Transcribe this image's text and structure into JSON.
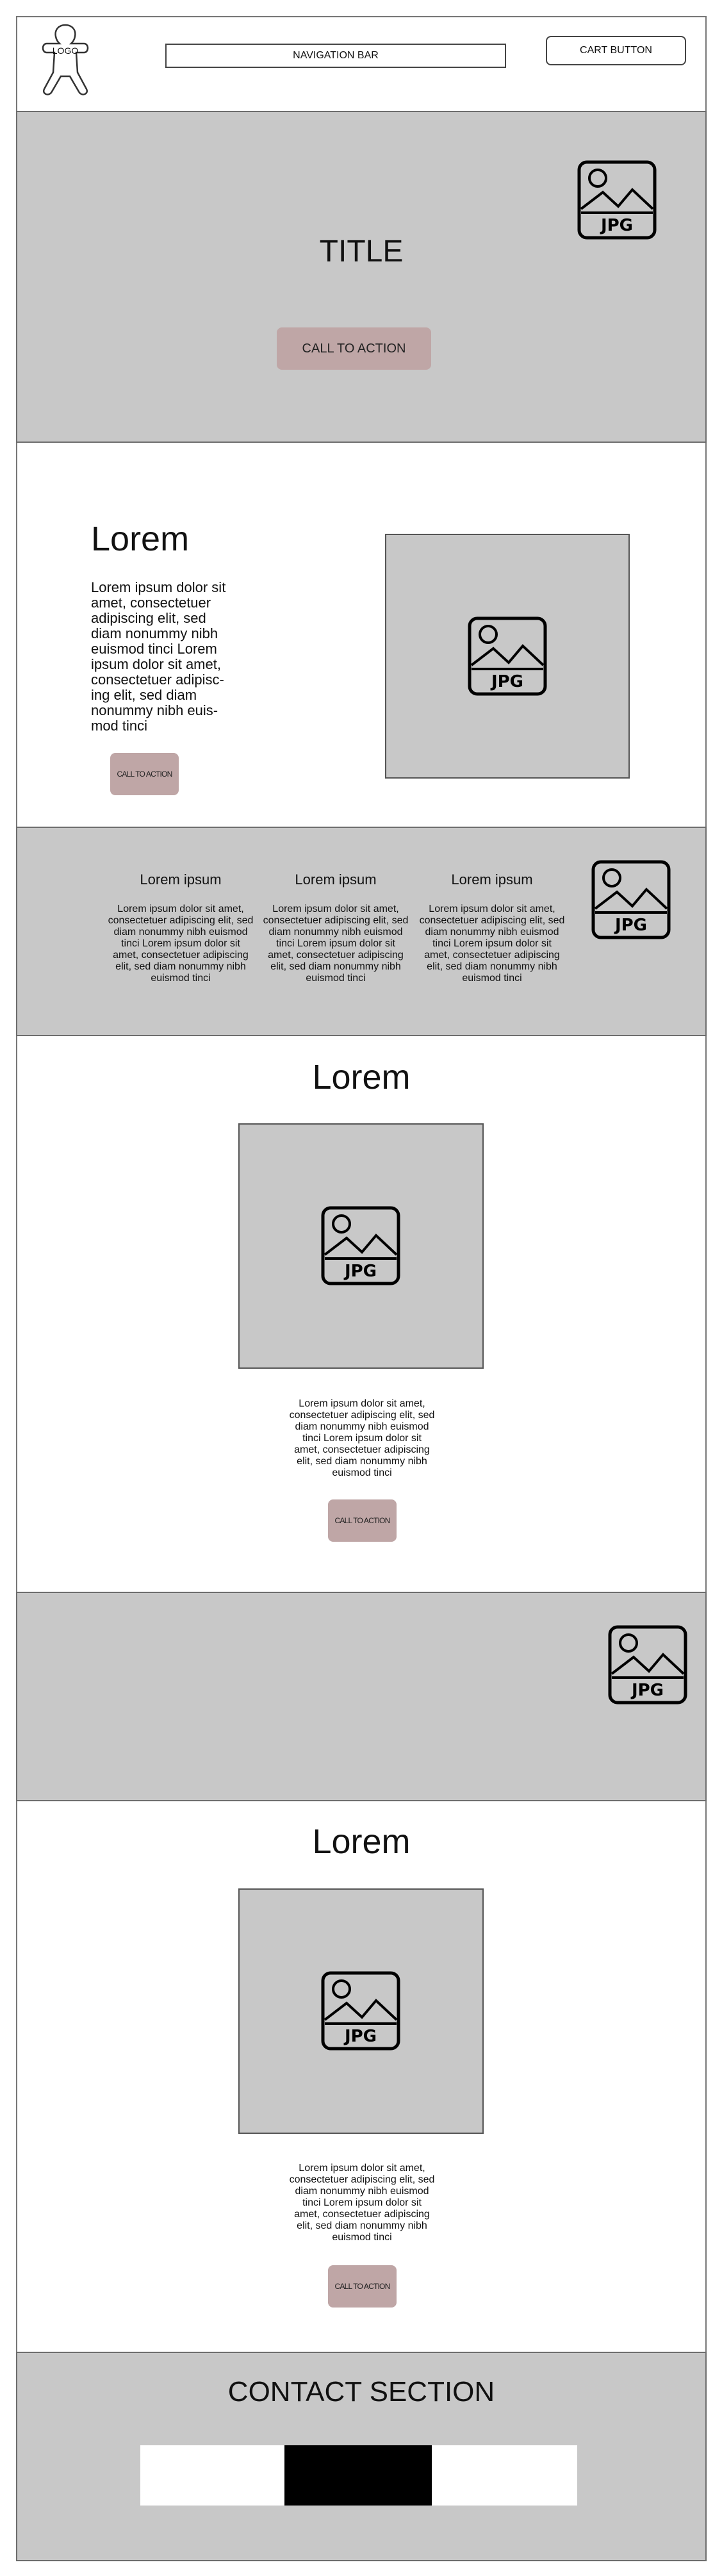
{
  "header": {
    "logo_text": "LOGO",
    "nav_label": "NAVIGATION BAR",
    "cart_label": "CART BUTTON"
  },
  "hero": {
    "title": "TITLE",
    "cta_label": "CALL TO ACTION",
    "image_label": "JPG"
  },
  "section1": {
    "heading": "Lorem",
    "body": "Lorem ipsum dolor sit amet, consectetuer adipiscing elit, sed diam nonummy nibh euismod tinci Lorem ipsum dolor sit amet, consectetuer adipisc- ing elit, sed diam nonummy nibh euis- mod tinci",
    "cta_label": "CALL TO ACTION",
    "image_label": "JPG"
  },
  "columns": {
    "items": [
      {
        "title": "Lorem ipsum",
        "body": "Lorem ipsum dolor sit amet, consectetuer adipiscing elit, sed diam nonummy nibh euismod tinci Lorem ipsum dolor sit amet, consectetuer adipiscing elit, sed diam nonummy nibh euismod tinci"
      },
      {
        "title": "Lorem ipsum",
        "body": "Lorem ipsum dolor sit amet, consectetuer adipiscing elit, sed diam nonummy nibh euismod tinci Lorem ipsum dolor sit amet, consectetuer adipiscing elit, sed diam nonummy nibh euismod tinci"
      },
      {
        "title": "Lorem ipsum",
        "body": "Lorem ipsum dolor sit amet, consectetuer adipiscing elit, sed diam nonummy nibh euismod tinci Lorem ipsum dolor sit amet, consectetuer adipiscing elit, sed diam nonummy nibh euismod tinci"
      }
    ],
    "image_label": "JPG"
  },
  "section2": {
    "heading": "Lorem",
    "image_label": "JPG",
    "body": "Lorem ipsum dolor sit amet, consectetuer adipiscing elit, sed diam nonummy nibh euismod tinci Lorem ipsum dolor sit amet, consectetuer adipiscing elit, sed diam nonummy nibh euismod tinci",
    "cta_label": "CALL TO ACTION"
  },
  "banner": {
    "image_label": "JPG"
  },
  "section3": {
    "heading": "Lorem",
    "image_label": "JPG",
    "body": "Lorem ipsum dolor sit amet, consectetuer adipiscing elit, sed diam nonummy nibh euismod tinci Lorem ipsum dolor sit amet, consectetuer adipiscing elit, sed diam nonummy nibh euismod tinci",
    "cta_label": "CALL TO ACTION"
  },
  "contact": {
    "title": "CONTACT SECTION"
  },
  "colors": {
    "band": "#c8c8c8",
    "cta": "#bfa6a6",
    "contact_black": "#000000"
  }
}
